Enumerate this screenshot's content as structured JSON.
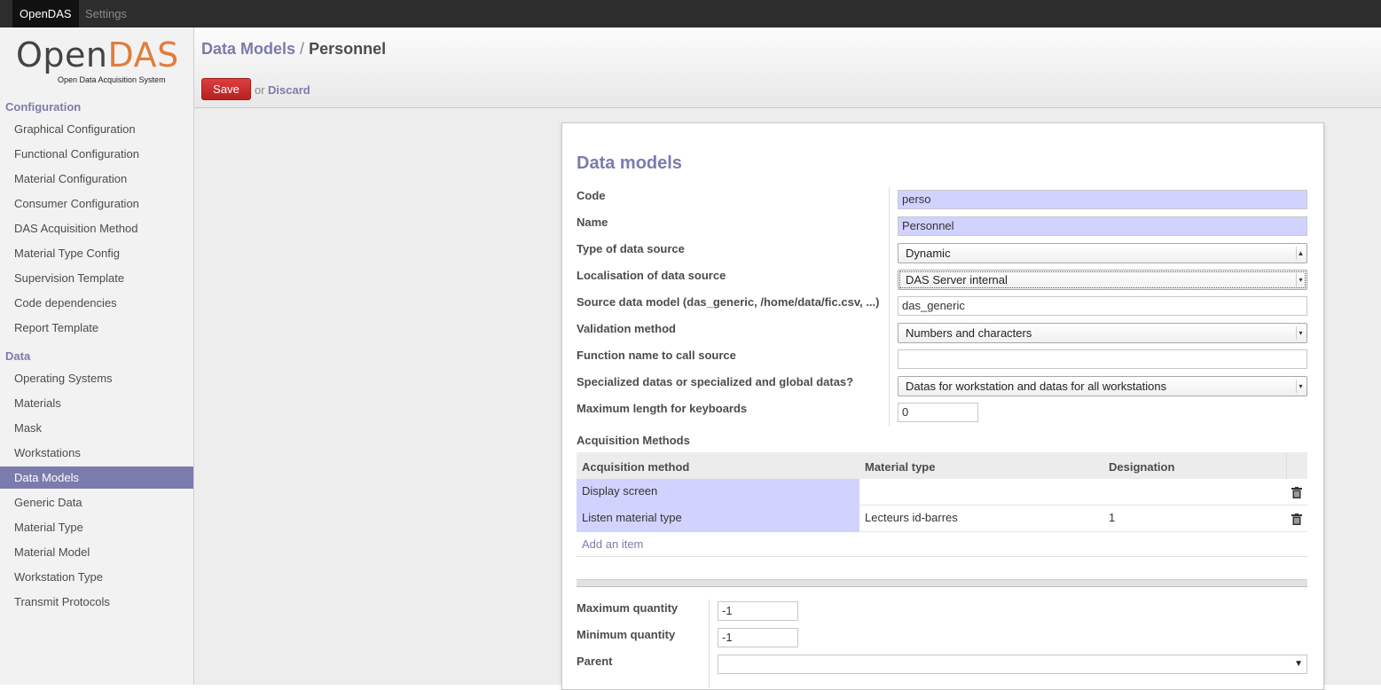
{
  "topbar": {
    "app_tab": "OpenDAS",
    "settings_tab": "Settings"
  },
  "logo": {
    "open": "Open",
    "das": "DAS",
    "subtitle": "Open Data Acquisition System"
  },
  "sidebar": {
    "configuration_heading": "Configuration",
    "configuration_items": [
      "Graphical Configuration",
      "Functional Configuration",
      "Material Configuration",
      "Consumer Configuration",
      "DAS Acquisition Method",
      "Material Type Config",
      "Supervision Template",
      "Code dependencies",
      "Report Template"
    ],
    "data_heading": "Data",
    "data_items": [
      "Operating Systems",
      "Materials",
      "Mask",
      "Workstations",
      "Data Models",
      "Generic Data",
      "Material Type",
      "Material Model",
      "Workstation Type",
      "Transmit Protocols"
    ],
    "active_item": "Data Models"
  },
  "header": {
    "breadcrumb_root": "Data Models",
    "breadcrumb_sep": "/",
    "breadcrumb_current": "Personnel",
    "save_label": "Save",
    "or_label": "or",
    "discard_label": "Discard"
  },
  "form": {
    "title": "Data models",
    "labels": {
      "code": "Code",
      "name": "Name",
      "type_source": "Type of data source",
      "localisation": "Localisation of data source",
      "source_model": "Source data model (das_generic, /home/data/fic.csv, ...)",
      "validation": "Validation method",
      "function_name": "Function name to call source",
      "specialized": "Specialized datas or specialized and global datas?",
      "max_length": "Maximum length for keyboards"
    },
    "values": {
      "code": "perso",
      "name": "Personnel",
      "type_source": "Dynamic",
      "localisation": "DAS Server internal",
      "source_model": "das_generic",
      "validation": "Numbers and characters",
      "function_name": "",
      "specialized": "Datas for workstation and datas for all workstations",
      "max_length": "0"
    }
  },
  "acquisition": {
    "title": "Acquisition Methods",
    "columns": [
      "Acquisition method",
      "Material type",
      "Designation"
    ],
    "rows": [
      {
        "method": "Display screen",
        "material_type": "",
        "designation": ""
      },
      {
        "method": "Listen material type",
        "material_type": "Lecteurs id-barres",
        "designation": "1"
      }
    ],
    "add_item": "Add an item"
  },
  "quantities": {
    "labels": {
      "max": "Maximum quantity",
      "min": "Minimum quantity",
      "parent": "Parent"
    },
    "values": {
      "max": "-1",
      "min": "-1",
      "parent": ""
    }
  },
  "colors": {
    "accent": "#7c7bad",
    "required_bg": "#d2d2ff",
    "save_button": "#c62d2d",
    "logo_orange": "#e07d3c"
  }
}
